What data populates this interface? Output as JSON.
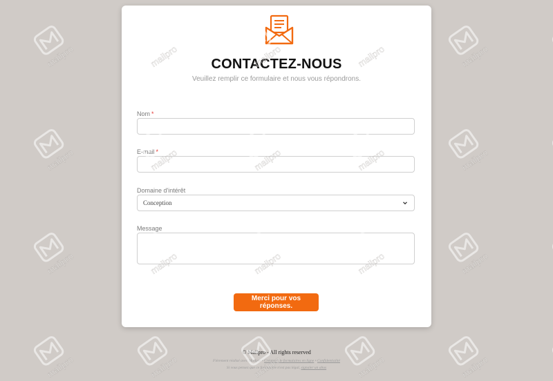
{
  "form": {
    "title": "CONTACTEZ-NOUS",
    "subtitle": "Veuillez remplir ce formulaire et nous vous répondrons.",
    "fields": {
      "name": {
        "label": "Nom",
        "required_mark": "*",
        "value": ""
      },
      "email": {
        "label": "E-mail",
        "required_mark": "*",
        "value": ""
      },
      "interest": {
        "label": "Domaine d'intérêt",
        "selected": "Conception"
      },
      "message": {
        "label": "Message",
        "value": ""
      }
    },
    "submit_label": "Merci pour vos réponses."
  },
  "footer": {
    "copyright": "© Mailpro - All rights reserved",
    "powered_text": "Fièrement réalisé avec",
    "powered_brand": "Mailpro",
    "sep1": "•",
    "creator_link": "Créateur de formulaires en ligne",
    "sep2": "•",
    "privacy_link": "Confidentialité",
    "abuse_text": "Si vous pensez que ce formulaire n'est pas légal,",
    "abuse_link": "signaler un abus"
  },
  "watermark": {
    "text": "mailpro",
    "color": "#ffffff"
  },
  "colors": {
    "accent": "#f26a10",
    "background": "#d0cbc7",
    "required": "#e53935"
  },
  "icons": {
    "logo": "envelope-letter-icon",
    "select_arrow": "chevron-down-icon"
  }
}
